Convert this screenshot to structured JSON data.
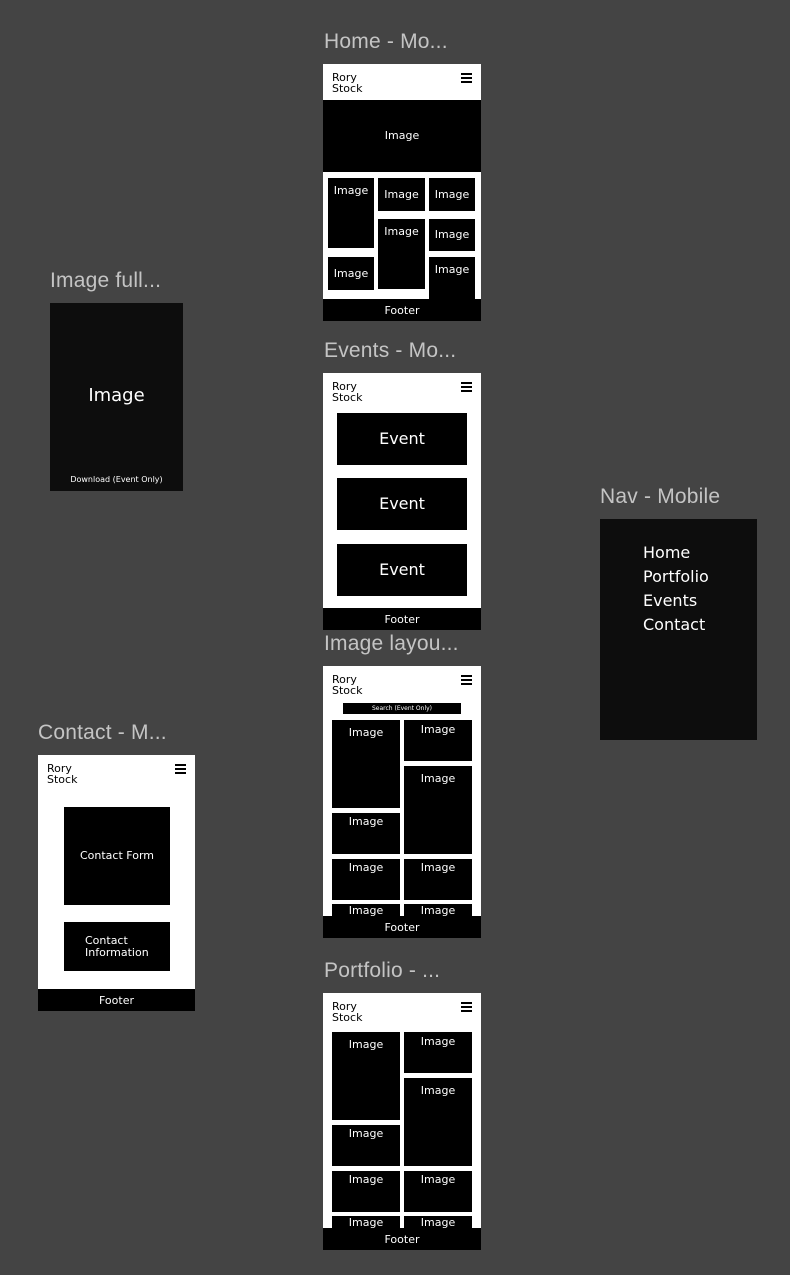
{
  "titles": {
    "home": "Home - Mo...",
    "image_full": "Image full...",
    "events": "Events - Mo...",
    "nav": "Nav - Mobile",
    "image_layout": "Image layou...",
    "contact": "Contact - M...",
    "portfolio": "Portfolio - ..."
  },
  "brand": {
    "logo": "Rory\nStock"
  },
  "common": {
    "image": "Image",
    "footer": "Footer",
    "event": "Event"
  },
  "image_full": {
    "image": "Image",
    "download": "Download (Event Only)"
  },
  "nav": {
    "items": [
      "Home",
      "Portfolio",
      "Events",
      "Contact"
    ]
  },
  "image_layout": {
    "search": "Search (Event Only)"
  },
  "contact": {
    "form": "Contact Form",
    "information": "Contact\nInformation"
  }
}
